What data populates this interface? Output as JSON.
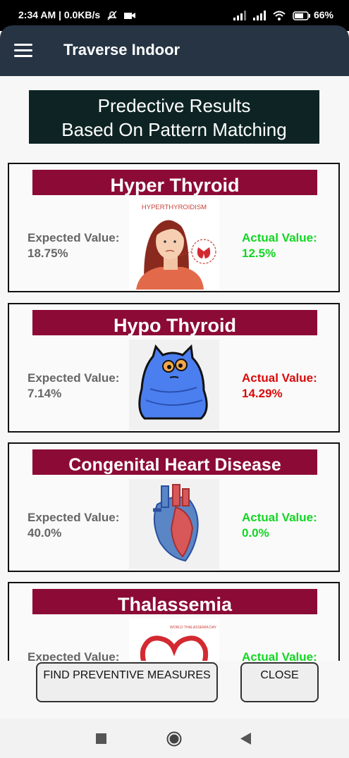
{
  "status": {
    "time": "2:34 AM | 0.0KB/s",
    "battery": "66"
  },
  "appbar": {
    "title": "Traverse Indoor"
  },
  "header": {
    "line1": "Predective Results",
    "line2": "Based On Pattern Matching"
  },
  "cards": [
    {
      "title": "Hyper Thyroid",
      "expected_label": "Expected Value:",
      "expected_value": "18.75%",
      "actual_label": "Actual Value:",
      "actual_value": "12.5%",
      "actual_color": "green",
      "image_caption": "HYPERTHYROIDISM"
    },
    {
      "title": "Hypo Thyroid",
      "expected_label": "Expected Value:",
      "expected_value": "7.14%",
      "actual_label": "Actual Value:",
      "actual_value": "14.29%",
      "actual_color": "red"
    },
    {
      "title": "Congenital Heart Disease",
      "expected_label": "Expected Value:",
      "expected_value": "40.0%",
      "actual_label": "Actual Value:",
      "actual_value": "0.0%",
      "actual_color": "green"
    },
    {
      "title": "Thalassemia",
      "expected_label": "Expected Value:",
      "actual_label": "Actual Value:",
      "actual_color": "green",
      "image_caption": "WORLD THALASSEMIA DAY"
    }
  ],
  "buttons": {
    "find": "FIND PREVENTIVE MEASURES",
    "close": "CLOSE"
  },
  "colors": {
    "appbar": "#263444",
    "card_title_bg": "#8c0a36",
    "header_bg": "#0e2424",
    "green": "#13d623",
    "red": "#d90a0a"
  },
  "icons": [
    "menu-icon",
    "back-icon",
    "home-icon",
    "recents-icon",
    "wifi-icon",
    "signal-icon",
    "battery-icon",
    "camera-icon",
    "mute-icon"
  ]
}
